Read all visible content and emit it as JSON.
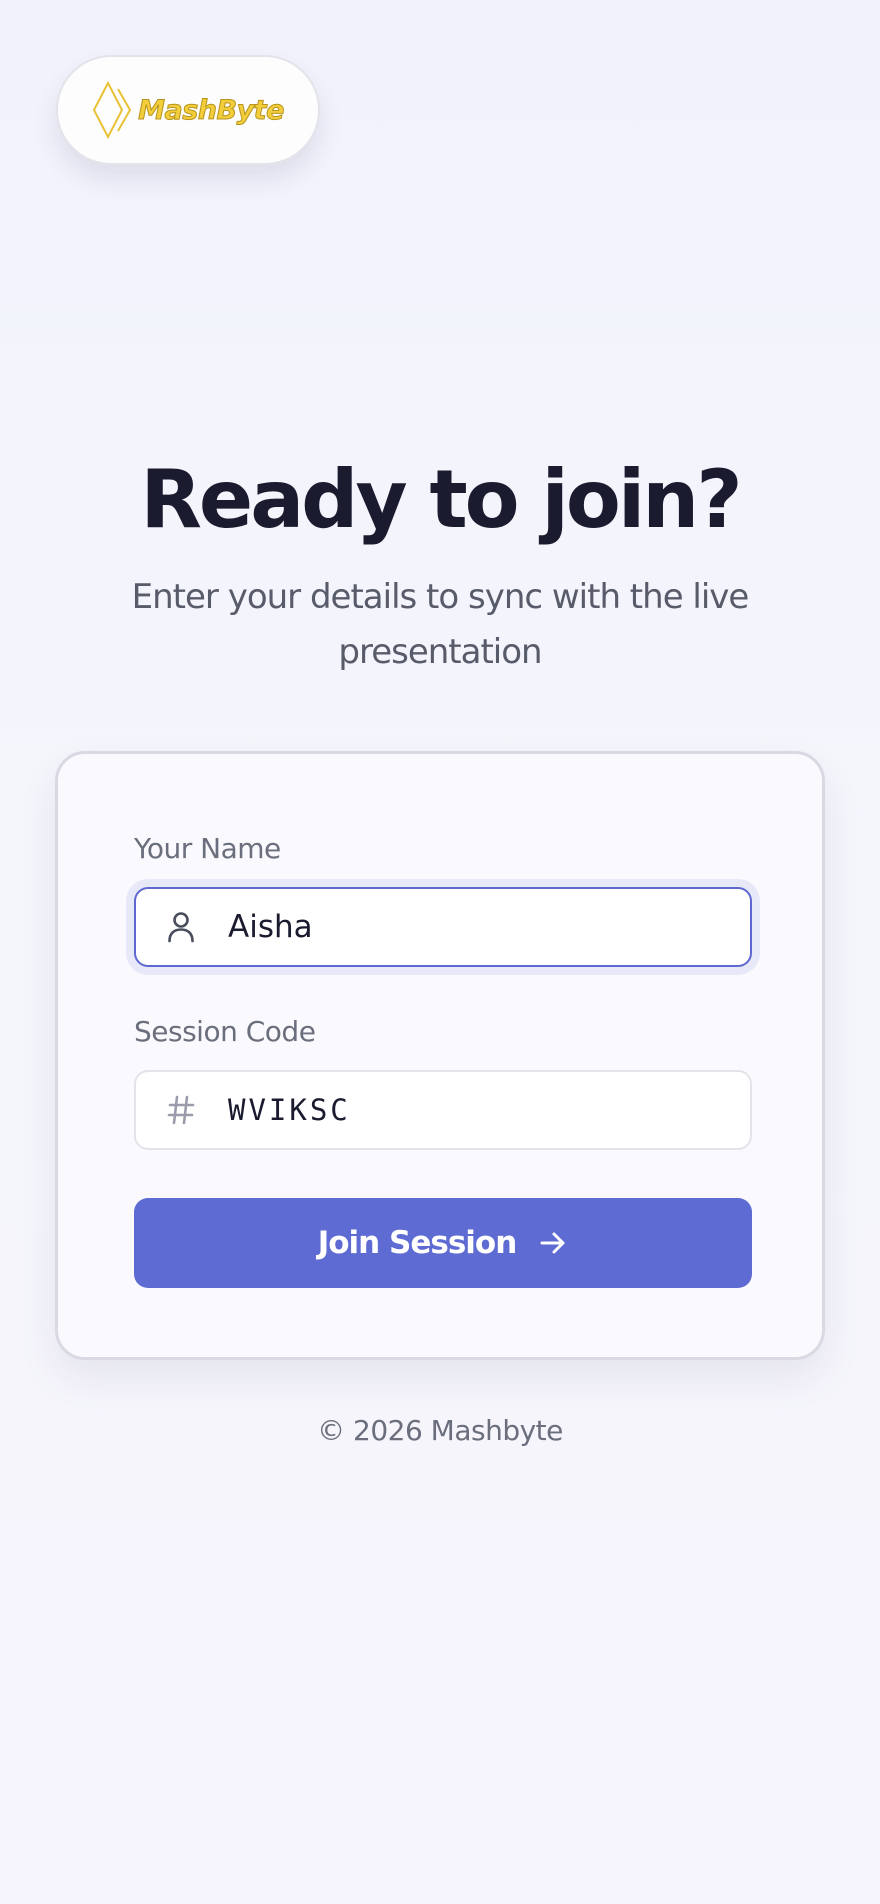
{
  "brand": {
    "logo_text": "MashByte",
    "logo_icon": "diamond-logo-icon",
    "logo_color": "#f2cd3c"
  },
  "heading": "Ready to join?",
  "subheading": "Enter your details to sync with the live presentation",
  "form": {
    "name": {
      "label": "Your Name",
      "value": "Aisha",
      "icon": "user-icon"
    },
    "code": {
      "label": "Session Code",
      "value": "WVIKSC",
      "icon": "hash-icon"
    },
    "submit": {
      "label": "Join Session",
      "icon": "arrow-right-icon"
    }
  },
  "footer": "© 2026 Mashbyte",
  "colors": {
    "accent": "#5e6bd3",
    "heading": "#1a1b2e",
    "muted": "#6b6e7c"
  }
}
